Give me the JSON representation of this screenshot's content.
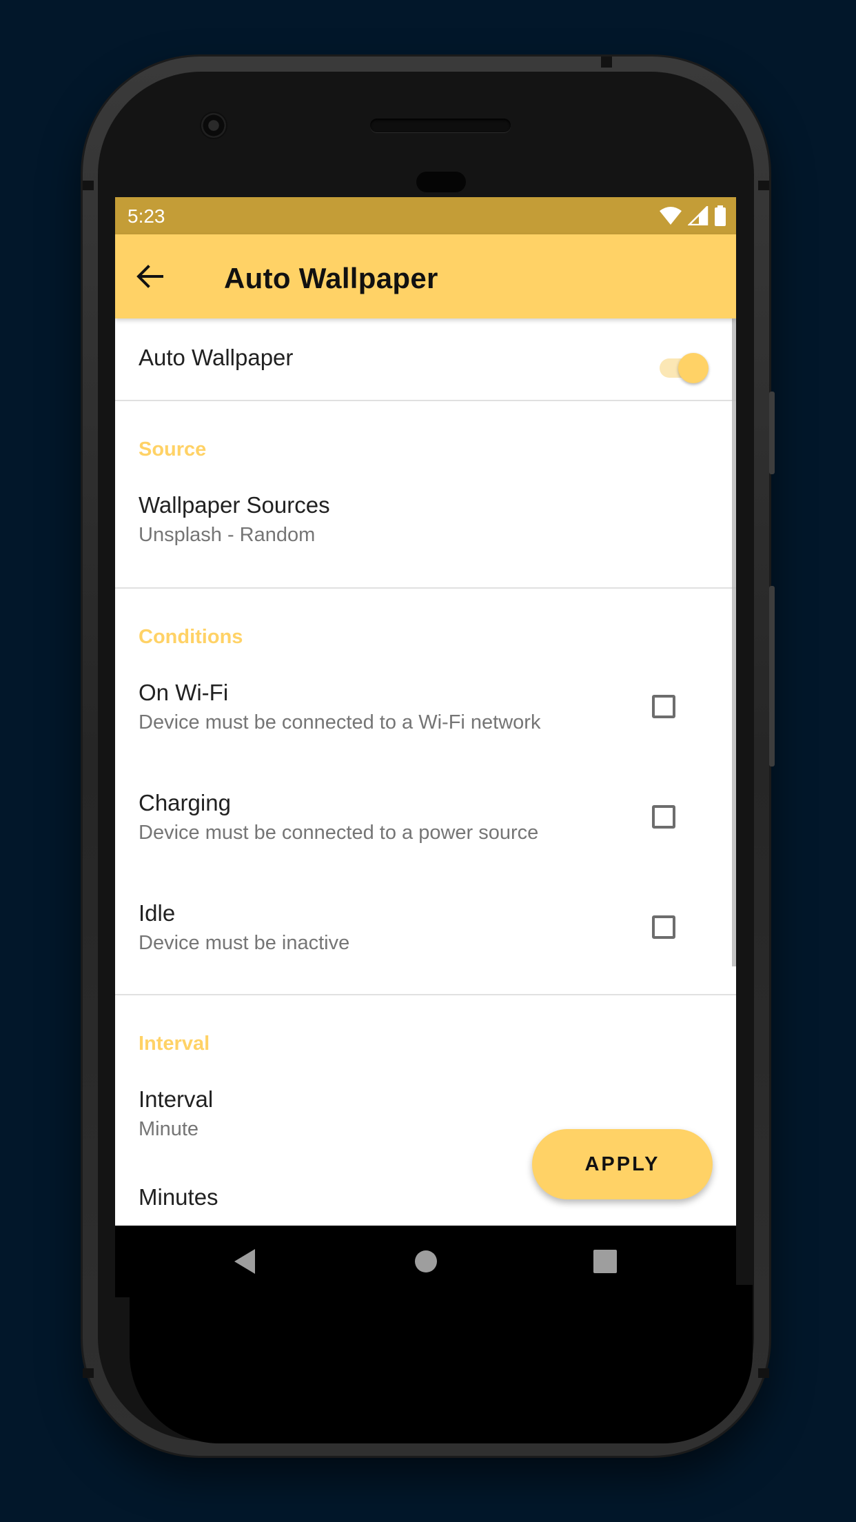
{
  "status_bar": {
    "time": "5:23",
    "icons": [
      "wifi-icon",
      "signal-icon",
      "battery-icon"
    ]
  },
  "app_bar": {
    "title": "Auto Wallpaper",
    "back_icon": "arrow-back-icon"
  },
  "master_switch": {
    "label": "Auto Wallpaper",
    "enabled": true
  },
  "sections": {
    "source": {
      "header": "Source",
      "items": [
        {
          "title": "Wallpaper Sources",
          "summary": "Unsplash - Random"
        }
      ]
    },
    "conditions": {
      "header": "Conditions",
      "items": [
        {
          "title": "On Wi-Fi",
          "summary": "Device must be connected to a Wi-Fi network",
          "checked": false
        },
        {
          "title": "Charging",
          "summary": "Device must be connected to a power source",
          "checked": false
        },
        {
          "title": "Idle",
          "summary": "Device must be inactive",
          "checked": false
        }
      ]
    },
    "interval": {
      "header": "Interval",
      "items": [
        {
          "title": "Interval",
          "summary": "Minute"
        },
        {
          "title": "Minutes",
          "summary": ""
        }
      ]
    }
  },
  "fab": {
    "label": "APPLY"
  },
  "nav_bar": {
    "icons": [
      "nav-back-icon",
      "nav-home-icon",
      "nav-recents-icon"
    ]
  },
  "colors": {
    "accent": "#ffd266",
    "status_bar": "#c49d37",
    "background": "#02172a"
  }
}
